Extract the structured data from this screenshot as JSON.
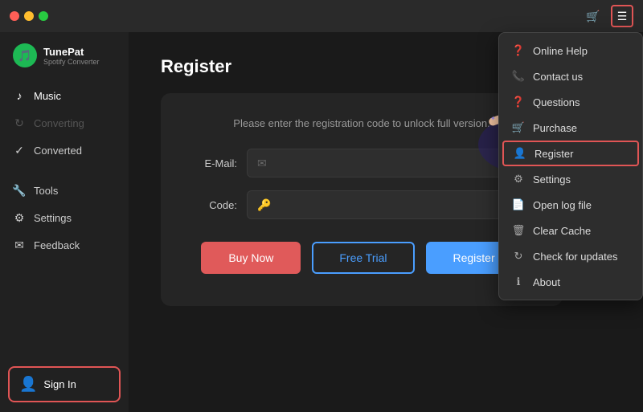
{
  "app": {
    "title": "TunePat",
    "subtitle": "Spotify Converter"
  },
  "titlebar": {
    "cart_icon": "🛒",
    "menu_icon": "☰"
  },
  "sidebar": {
    "items": [
      {
        "id": "music",
        "label": "Music",
        "icon": "♪",
        "active": true
      },
      {
        "id": "converting",
        "label": "Converting",
        "icon": "↻",
        "dimmed": true
      },
      {
        "id": "converted",
        "label": "Converted",
        "icon": "✓"
      }
    ],
    "tools_items": [
      {
        "id": "tools",
        "label": "Tools",
        "icon": "⚙"
      },
      {
        "id": "settings",
        "label": "Settings",
        "icon": "⚙"
      },
      {
        "id": "feedback",
        "label": "Feedback",
        "icon": "✉"
      }
    ],
    "sign_in": "Sign In"
  },
  "page": {
    "title": "Register",
    "subtitle": "Please enter the registration code to unlock full version.",
    "email_label": "E-Mail:",
    "code_label": "Code:",
    "email_placeholder": "",
    "code_placeholder": "",
    "btn_buy": "Buy Now",
    "btn_trial": "Free Trial",
    "btn_register": "Register"
  },
  "menu": {
    "items": [
      {
        "id": "online-help",
        "label": "Online Help",
        "icon": "?"
      },
      {
        "id": "contact-us",
        "label": "Contact us",
        "icon": "☎"
      },
      {
        "id": "questions",
        "label": "Questions",
        "icon": "?"
      },
      {
        "id": "purchase",
        "label": "Purchase",
        "icon": "🛒"
      },
      {
        "id": "register",
        "label": "Register",
        "icon": "👤",
        "highlighted": true
      },
      {
        "id": "settings",
        "label": "Settings",
        "icon": "⚙"
      },
      {
        "id": "open-log",
        "label": "Open log file",
        "icon": "📄"
      },
      {
        "id": "clear-cache",
        "label": "Clear Cache",
        "icon": "🗑"
      },
      {
        "id": "check-updates",
        "label": "Check for updates",
        "icon": "↻"
      },
      {
        "id": "about",
        "label": "About",
        "icon": "ℹ"
      }
    ]
  }
}
